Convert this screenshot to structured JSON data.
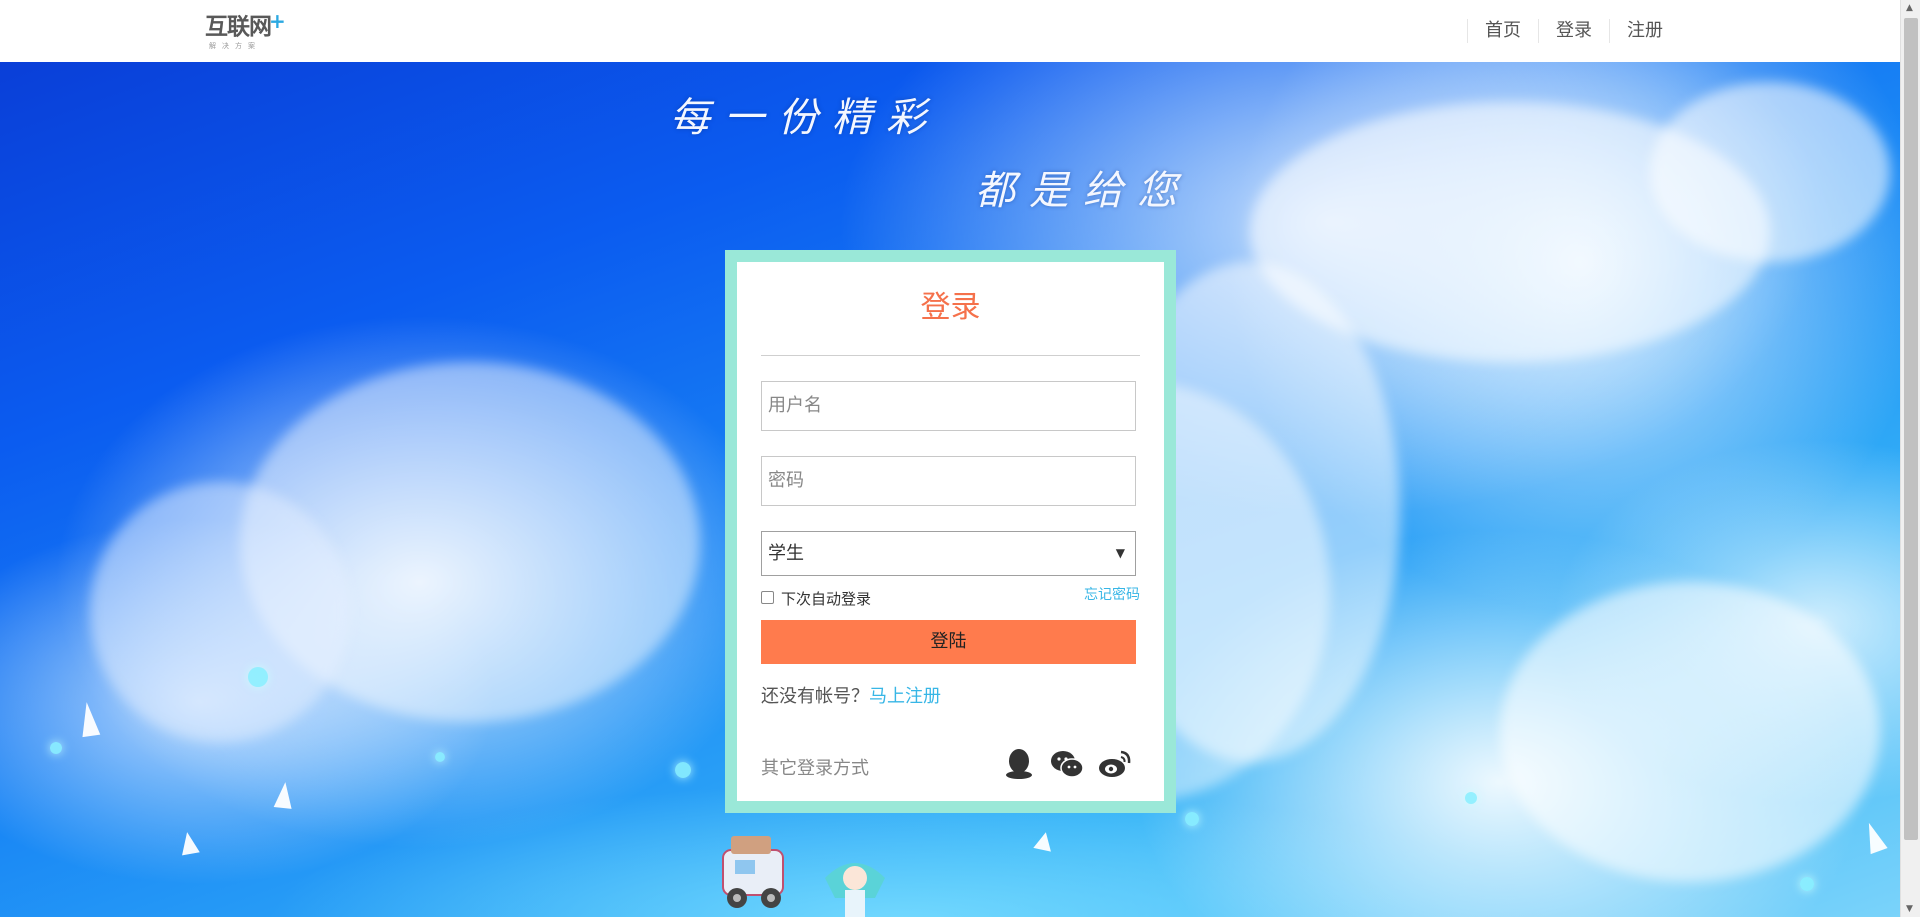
{
  "header": {
    "logo_text": "互联网",
    "logo_plus": "+",
    "logo_sub": "解决方案",
    "nav": [
      {
        "label": "首页"
      },
      {
        "label": "登录"
      },
      {
        "label": "注册"
      }
    ]
  },
  "background": {
    "slogan_line1": "每一份精彩",
    "slogan_line2": "都是给您"
  },
  "login": {
    "title": "登录",
    "username_placeholder": "用户名",
    "password_placeholder": "密码",
    "role_selected": "学生",
    "remember_label": "下次自动登录",
    "forgot_label": "忘记密码",
    "submit_label": "登陆",
    "no_account_text": "还没有帐号？",
    "register_link": "马上注册",
    "other_login_label": "其它登录方式",
    "social_icons": [
      "qq-icon",
      "wechat-icon",
      "weibo-icon"
    ]
  },
  "colors": {
    "accent_orange": "#ff7b4d",
    "title_orange": "#f5714b",
    "link_blue": "#37b6e6",
    "panel_border": "#9ae8d8"
  }
}
